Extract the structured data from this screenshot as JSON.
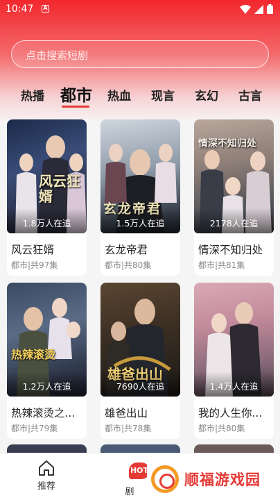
{
  "status_bar": {
    "time": "10:47",
    "indicator": "A"
  },
  "search": {
    "placeholder": "点击搜索短剧"
  },
  "tabs": [
    {
      "label": "热播",
      "active": false
    },
    {
      "label": "都市",
      "active": true
    },
    {
      "label": "热血",
      "active": false
    },
    {
      "label": "现言",
      "active": false
    },
    {
      "label": "玄幻",
      "active": false
    },
    {
      "label": "古言",
      "active": false
    }
  ],
  "dramas": [
    {
      "title": "风云狂婿",
      "meta": "都市|共97集",
      "fans": "1.8万人在追",
      "poster_text": "风云狂婿"
    },
    {
      "title": "玄龙帝君",
      "meta": "都市|共80集",
      "fans": "1.5万人在追",
      "poster_text": "玄龙帝君"
    },
    {
      "title": "情深不知归处",
      "meta": "都市|共81集",
      "fans": "2178人在追",
      "poster_text": "情深不知归处"
    },
    {
      "title": "热辣滚烫之...",
      "meta": "都市|共79集",
      "fans": "1.2万人在追",
      "poster_text": "热辣滚烫"
    },
    {
      "title": "雄爸出山",
      "meta": "都市|共78集",
      "fans": "7690人在追",
      "poster_text": "雄爸出山"
    },
    {
      "title": "我的人生你...",
      "meta": "都市|共80集",
      "fans": "1.4万人在追",
      "poster_text": ""
    }
  ],
  "bottom_nav": {
    "home_label": "推荐",
    "drama_label": "剧",
    "hot_badge": "HOT"
  },
  "watermark": {
    "text": "顺福游戏园"
  },
  "colors": {
    "accent": "#e53935",
    "header_top": "#f2272c"
  }
}
